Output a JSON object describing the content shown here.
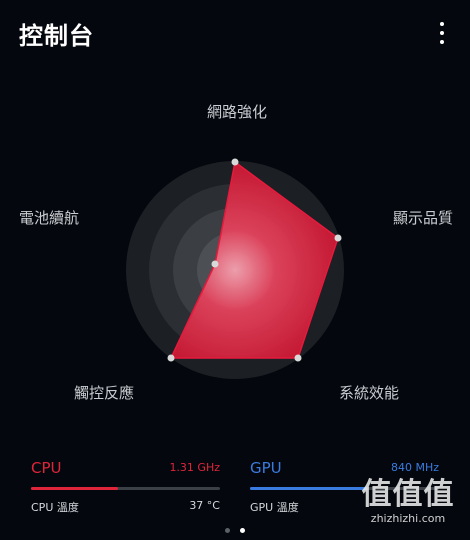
{
  "header": {
    "title": "控制台",
    "menu_icon": "more-vertical-icon"
  },
  "radar": {
    "labels": {
      "network": "網路強化",
      "display": "顯示品質",
      "system": "系統效能",
      "touch": "觸控反應",
      "battery": "電池續航"
    },
    "colors": {
      "fill": "#e8193c",
      "point": "#d9d9d9"
    }
  },
  "cpu": {
    "name": "CPU",
    "freq": "1.31 GHz",
    "temp_label": "CPU 溫度",
    "temp_value": "37 °C",
    "usage": 0.46,
    "color": "#e0243a"
  },
  "gpu": {
    "name": "GPU",
    "freq": "840 MHz",
    "temp_label": "GPU 溫度",
    "color": "#3a7bdf"
  },
  "pager": {
    "pages": 2,
    "active": 1
  },
  "watermark": {
    "big": "值值值",
    "small": "zhizhizhi.com"
  }
}
